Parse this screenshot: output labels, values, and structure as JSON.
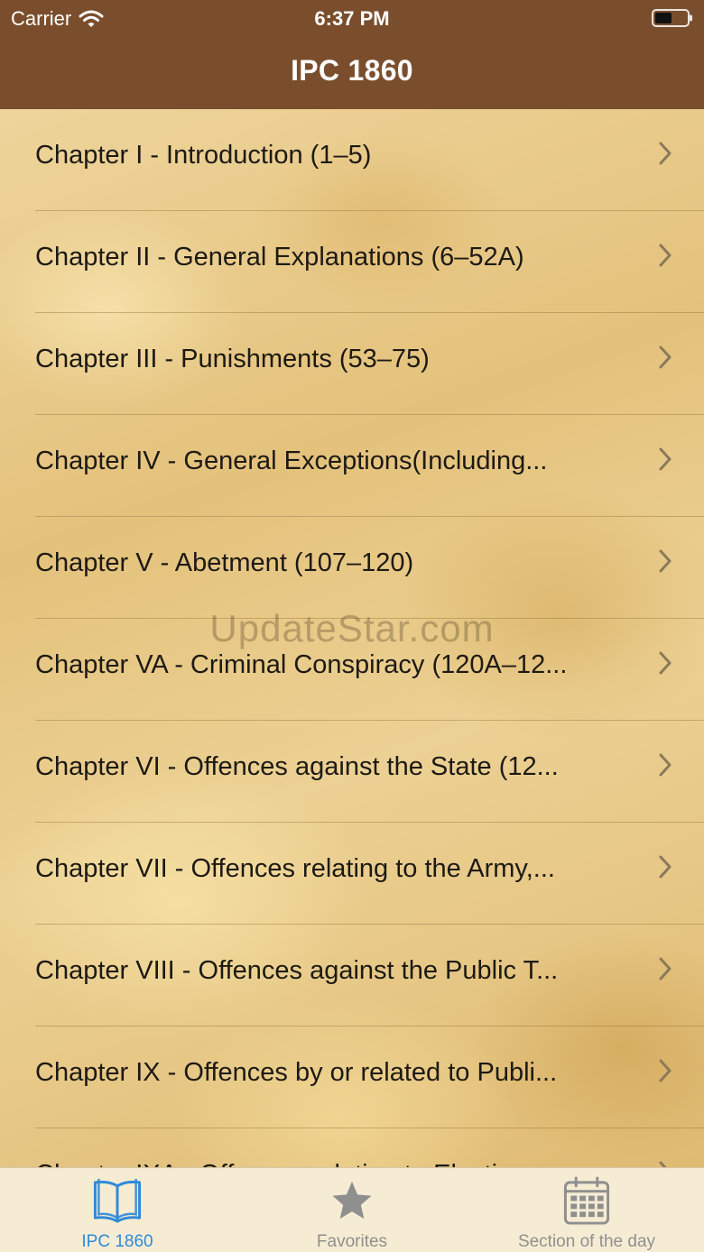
{
  "status_bar": {
    "carrier": "Carrier",
    "time": "6:37 PM"
  },
  "nav": {
    "title": "IPC 1860"
  },
  "chapters": [
    {
      "label": "Chapter I - Introduction (1–5)"
    },
    {
      "label": "Chapter II - General Explanations (6–52A)"
    },
    {
      "label": "Chapter III - Punishments (53–75)"
    },
    {
      "label": "Chapter IV - General Exceptions(Including..."
    },
    {
      "label": "Chapter V - Abetment (107–120)"
    },
    {
      "label": "Chapter VA - Criminal Conspiracy (120A–12..."
    },
    {
      "label": "Chapter VI - Offences against the State (12..."
    },
    {
      "label": "Chapter VII - Offences relating to the Army,..."
    },
    {
      "label": "Chapter VIII - Offences against the Public T..."
    },
    {
      "label": "Chapter IX - Offences by or related to Publi..."
    },
    {
      "label": "Chapter IXA - Offences relating to Electi..."
    }
  ],
  "watermark": "UpdateStar.com",
  "tabs": [
    {
      "label": "IPC 1860",
      "icon": "book-icon",
      "active": true
    },
    {
      "label": "Favorites",
      "icon": "star-icon",
      "active": false
    },
    {
      "label": "Section of the day",
      "icon": "calendar-icon",
      "active": false
    }
  ],
  "colors": {
    "nav_background": "#7a4e2d",
    "tab_active": "#2f8ad8",
    "tab_inactive": "#8f8f8f",
    "tab_background": "#f6ecd3"
  }
}
